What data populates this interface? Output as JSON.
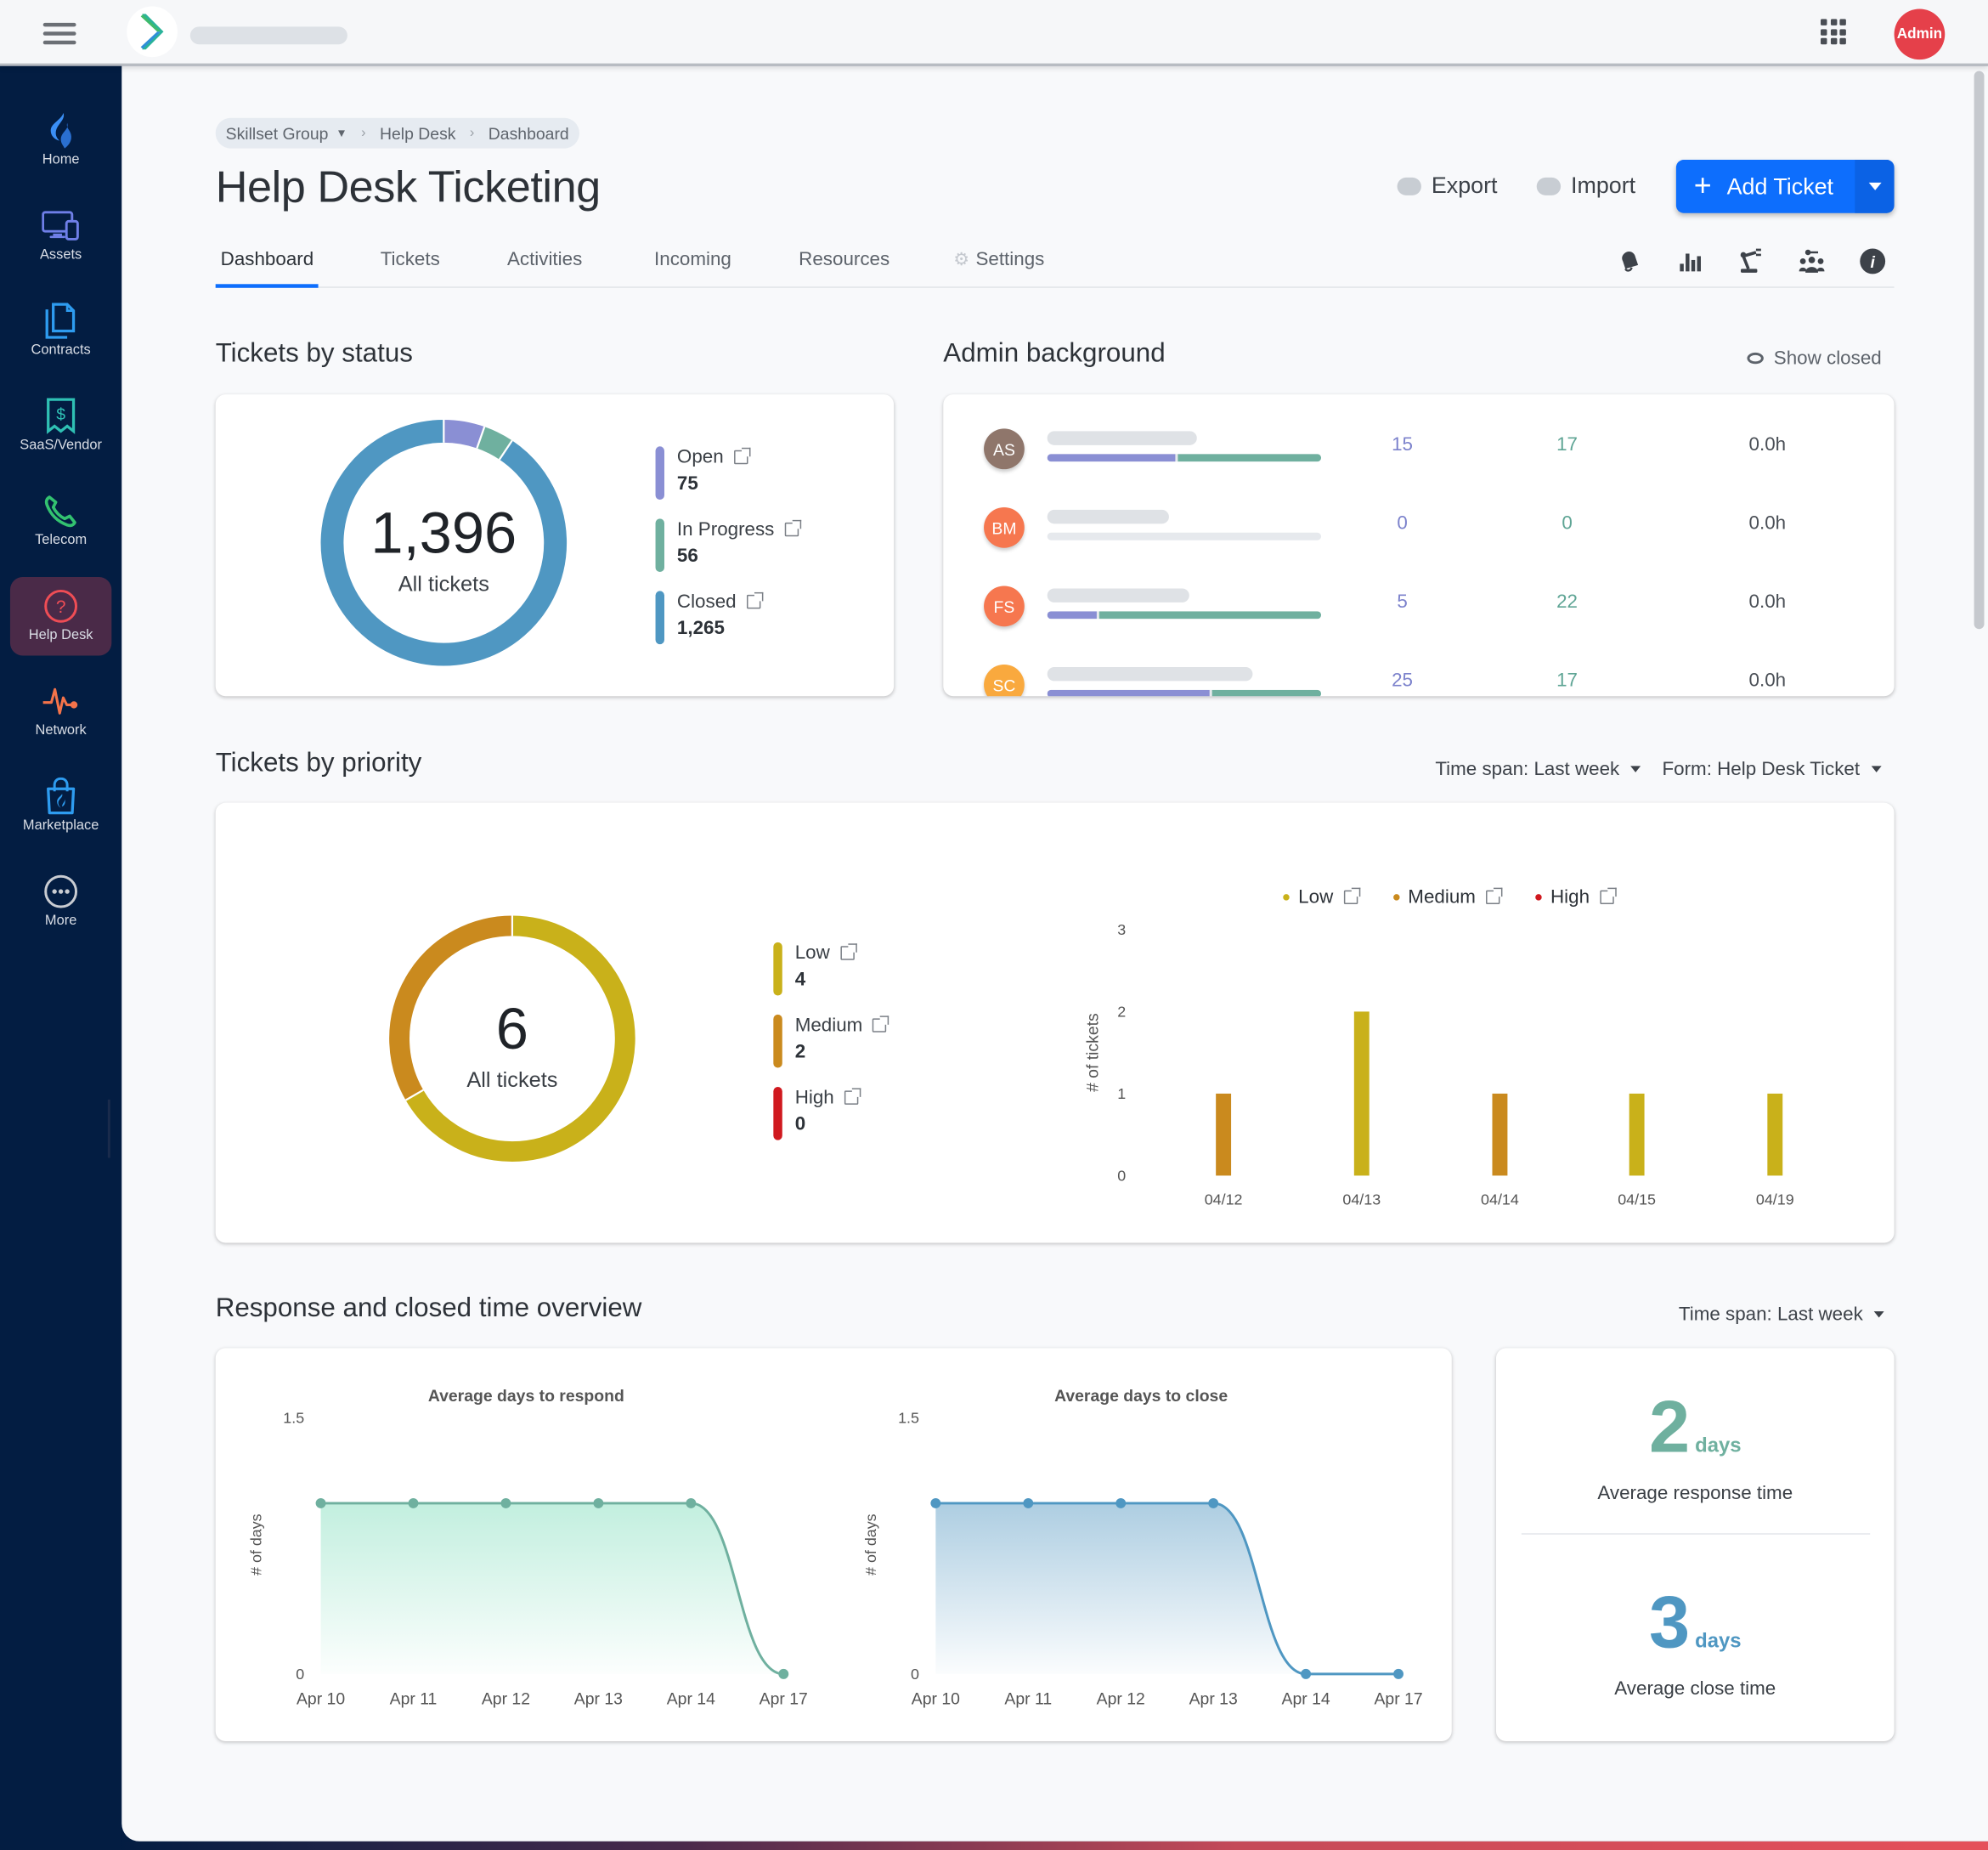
{
  "topbar": {
    "menu_icon": "hamburger-icon",
    "logo_icon": "chevron-logo-icon",
    "apps_icon": "grid-apps-icon",
    "user_avatar": "Admin"
  },
  "sidebar": {
    "items": [
      {
        "label": "Home",
        "icon": "flame-icon",
        "color": "#3b8ff5"
      },
      {
        "label": "Assets",
        "icon": "devices-icon",
        "color": "#6f7fe8"
      },
      {
        "label": "Contracts",
        "icon": "documents-icon",
        "color": "#2e9cf0"
      },
      {
        "label": "SaaS/Vendor",
        "icon": "receipt-dollar-icon",
        "color": "#2fc0b4"
      },
      {
        "label": "Telecom",
        "icon": "phone-icon",
        "color": "#33c270"
      },
      {
        "label": "Help Desk",
        "icon": "question-circle-icon",
        "color": "#ef4d55",
        "active": true
      },
      {
        "label": "Network",
        "icon": "pulse-icon",
        "color": "#f4734a"
      },
      {
        "label": "Marketplace",
        "icon": "shopping-bag-icon",
        "color": "#2e9cf0"
      },
      {
        "label": "More",
        "icon": "more-circle-icon",
        "color": "#c9ccd2"
      }
    ]
  },
  "breadcrumb": {
    "items": [
      "Skillset Group",
      "Help Desk",
      "Dashboard"
    ]
  },
  "header": {
    "title": "Help Desk Ticketing",
    "export_label": "Export",
    "import_label": "Import",
    "add_ticket_label": "Add Ticket"
  },
  "tabs": [
    {
      "label": "Dashboard",
      "active": true
    },
    {
      "label": "Tickets"
    },
    {
      "label": "Activities"
    },
    {
      "label": "Incoming"
    },
    {
      "label": "Resources"
    },
    {
      "label": "Settings",
      "icon": "gear-icon"
    }
  ],
  "toolbar_icons": [
    "bell-icon",
    "bar-chart-icon",
    "robot-arm-icon",
    "people-key-icon",
    "info-icon"
  ],
  "status_section": {
    "title": "Tickets by status",
    "total": "1,396",
    "total_label": "All tickets",
    "items": [
      {
        "label": "Open",
        "value": "75",
        "color": "#8a8fd4"
      },
      {
        "label": "In Progress",
        "value": "56",
        "color": "#6fb09f"
      },
      {
        "label": "Closed",
        "value": "1,265",
        "color": "#4f97c2"
      }
    ]
  },
  "admin_section": {
    "title": "Admin background",
    "show_closed_label": "Show closed",
    "rows": [
      {
        "initials": "AS",
        "color": "#8f766b",
        "open": "15",
        "in_progress": "17",
        "time": "0.0h",
        "open_frac": 0.47,
        "prog_frac": 0.53
      },
      {
        "initials": "BM",
        "color": "#f6774f",
        "open": "0",
        "in_progress": "0",
        "time": "0.0h",
        "open_frac": 0,
        "prog_frac": 0
      },
      {
        "initials": "FS",
        "color": "#f6774f",
        "open": "5",
        "in_progress": "22",
        "time": "0.0h",
        "open_frac": 0.18,
        "prog_frac": 0.82
      },
      {
        "initials": "SC",
        "color": "#f9a93e",
        "open": "25",
        "in_progress": "17",
        "time": "0.0h",
        "open_frac": 0.6,
        "prog_frac": 0.4
      }
    ]
  },
  "priority_section": {
    "title": "Tickets by priority",
    "time_span": "Time span: Last week",
    "form": "Form: Help Desk Ticket",
    "total": "6",
    "total_label": "All tickets",
    "items": [
      {
        "label": "Low",
        "value": "4",
        "color": "#c9b11a"
      },
      {
        "label": "Medium",
        "value": "2",
        "color": "#ca8a1e"
      },
      {
        "label": "High",
        "value": "0",
        "color": "#d0191f"
      }
    ]
  },
  "response_section": {
    "title": "Response and closed time overview",
    "time_span": "Time span: Last week",
    "avg_response_value": "2",
    "avg_response_unit": "days",
    "avg_response_label": "Average response time",
    "avg_close_value": "3",
    "avg_close_unit": "days",
    "avg_close_label": "Average close time",
    "response_color": "#6fb09f",
    "close_color": "#4f97c2"
  },
  "chart_data": [
    {
      "type": "pie",
      "title": "Tickets by status",
      "categories": [
        "Open",
        "In Progress",
        "Closed"
      ],
      "values": [
        75,
        56,
        1265
      ],
      "colors": [
        "#8a8fd4",
        "#6fb09f",
        "#4f97c2"
      ]
    },
    {
      "type": "pie",
      "title": "Tickets by priority",
      "categories": [
        "Low",
        "Medium",
        "High"
      ],
      "values": [
        4,
        2,
        0
      ],
      "colors": [
        "#c9b11a",
        "#ca8a1e",
        "#d0191f"
      ]
    },
    {
      "type": "bar",
      "title": "",
      "categories": [
        "04/12",
        "04/13",
        "04/14",
        "04/15",
        "04/19"
      ],
      "series": [
        {
          "name": "Low",
          "values": [
            0,
            2,
            0,
            1,
            1
          ],
          "color": "#c9b11a"
        },
        {
          "name": "Medium",
          "values": [
            1,
            0,
            1,
            0,
            0
          ],
          "color": "#ca8a1e"
        },
        {
          "name": "High",
          "values": [
            0,
            0,
            0,
            0,
            0
          ],
          "color": "#d0191f"
        }
      ],
      "xlabel": "",
      "ylabel": "# of tickets",
      "ylim": [
        0,
        3
      ],
      "yticks": [
        "0",
        "1",
        "2",
        "3"
      ],
      "legend": "top-center"
    },
    {
      "type": "area",
      "title": "Average days to respond",
      "x": [
        "Apr 10",
        "Apr 11",
        "Apr 12",
        "Apr 13",
        "Apr 14",
        "Apr 17"
      ],
      "values": [
        1,
        1,
        1,
        1,
        1,
        0
      ],
      "ylabel": "# of days",
      "ylim": [
        0,
        1.5
      ],
      "yticks": [
        "0",
        "1.5"
      ],
      "color": "#6fb09f",
      "fill": "#bfeedd"
    },
    {
      "type": "area",
      "title": "Average days to close",
      "x": [
        "Apr 10",
        "Apr 11",
        "Apr 12",
        "Apr 13",
        "Apr 14",
        "Apr 17"
      ],
      "values": [
        1,
        1,
        1,
        1,
        0,
        0
      ],
      "ylabel": "# of days",
      "ylim": [
        0,
        1.5
      ],
      "yticks": [
        "0",
        "1.5"
      ],
      "color": "#4f97c2",
      "fill": "#a9cbe0"
    }
  ]
}
